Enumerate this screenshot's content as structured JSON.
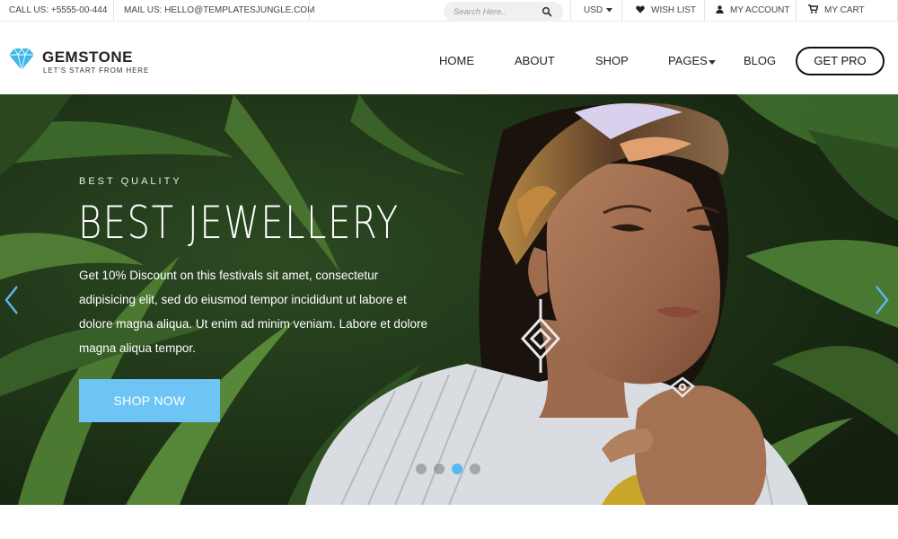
{
  "topbar": {
    "call": "CALL US: +5555-00-444",
    "mail": "MAIL US: HELLO@TEMPLATESJUNGLE.COM",
    "search_placeholder": "Search Here..",
    "currency": "USD",
    "wishlist": "WISH LIST",
    "account": "MY ACCOUNT",
    "cart": "MY CART"
  },
  "logo": {
    "name": "GEMSTONE",
    "tagline": "LET'S START FROM HERE",
    "gem_color": "#3fb6ea"
  },
  "nav": {
    "items": [
      "HOME",
      "ABOUT",
      "SHOP",
      "PAGES",
      "BLOG"
    ],
    "cta": "GET PRO"
  },
  "hero": {
    "eyebrow": "BEST QUALITY",
    "title": "BEST JEWELLERY",
    "description": "Get 10% Discount on this festivals sit amet, consectetur adipisicing elit, sed do eiusmod tempor incididunt ut labore et dolore magna aliqua. Ut enim ad minim veniam. Labore et dolore magna aliqua tempor.",
    "button": "SHOP NOW",
    "accent_color": "#6ec5f5",
    "slide_count": 4,
    "active_slide": 3,
    "prev_icon": "chevron-left-icon",
    "next_icon": "chevron-right-icon"
  }
}
